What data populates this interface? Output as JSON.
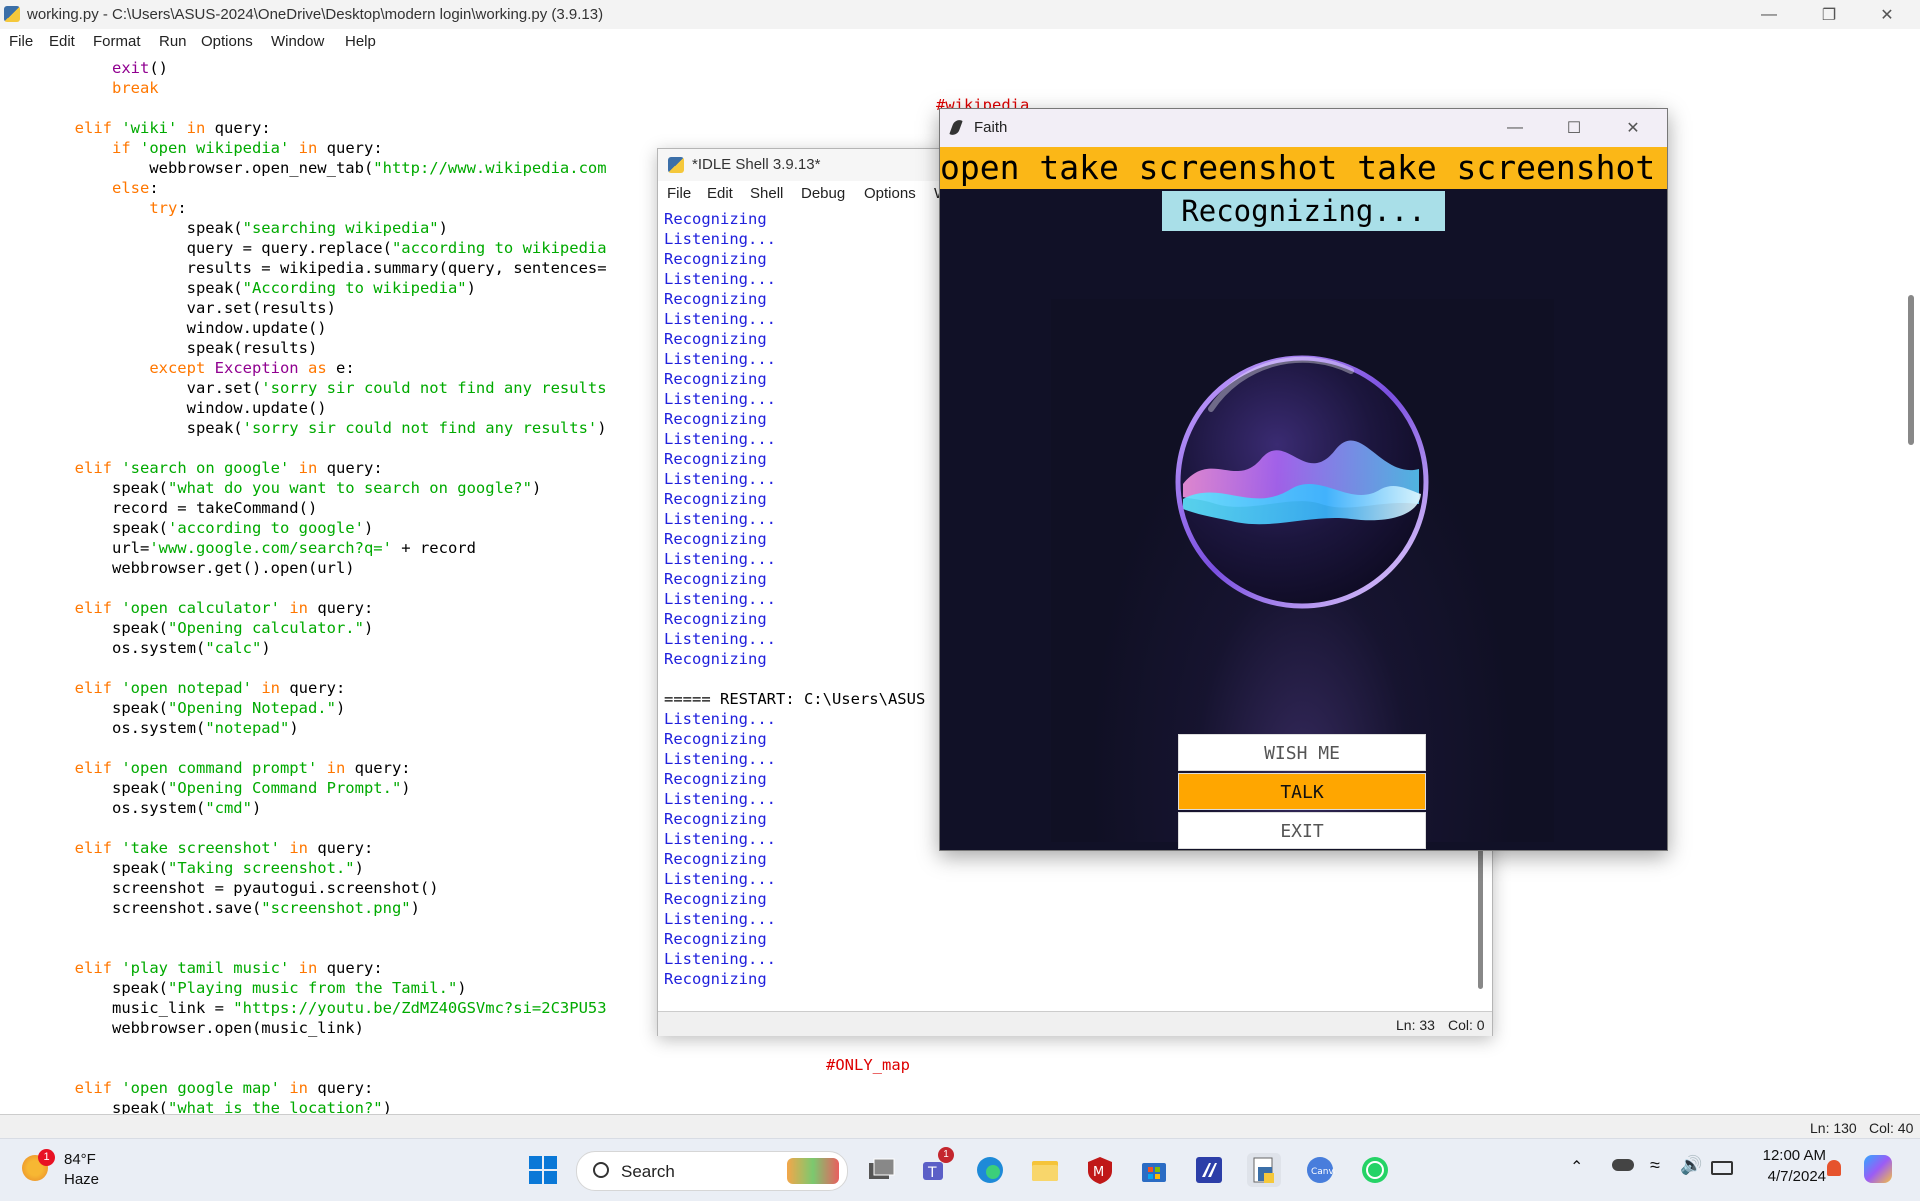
{
  "editor": {
    "title": "working.py - C:\\Users\\ASUS-2024\\OneDrive\\Desktop\\modern login\\working.py (3.9.13)",
    "menu": [
      "File",
      "Edit",
      "Format",
      "Run",
      "Options",
      "Window",
      "Help"
    ],
    "status_ln": "Ln: 130",
    "status_col": "Col: 40",
    "comment_wikipedia": "#wikipedia",
    "comment_map": "#ONLY_map"
  },
  "shell": {
    "title": "*IDLE Shell 3.9.13*",
    "menu": [
      "File",
      "Edit",
      "Shell",
      "Debug",
      "Options",
      "W"
    ],
    "restart_line": "===== RESTART: C:\\Users\\ASUS",
    "status_ln": "Ln: 33",
    "status_col": "Col: 0"
  },
  "faith": {
    "title": "Faith",
    "banner": "open take screenshot take screenshot",
    "status": "Recognizing...",
    "buttons": {
      "wish": "WISH ME",
      "talk": "TALK",
      "exit": "EXIT"
    }
  },
  "taskbar": {
    "weather_temp": "84°F",
    "weather_desc": "Haze",
    "weather_badge": "1",
    "search_label": "Search",
    "teams_badge": "1",
    "time": "12:00 AM",
    "date": "4/7/2024",
    "icons": [
      "windows-start-icon",
      "search-icon",
      "task-view-icon",
      "teams-icon",
      "edge-icon",
      "file-explorer-icon",
      "mcafee-icon",
      "microsoft-store-icon",
      "visual-studio-icon",
      "idle-python-icon",
      "canva-icon",
      "whatsapp-icon"
    ]
  },
  "colors": {
    "banner": "#fbb717",
    "talk": "#ffa600",
    "status_bg": "#a9dfe8",
    "faith_bg": "#111127"
  }
}
